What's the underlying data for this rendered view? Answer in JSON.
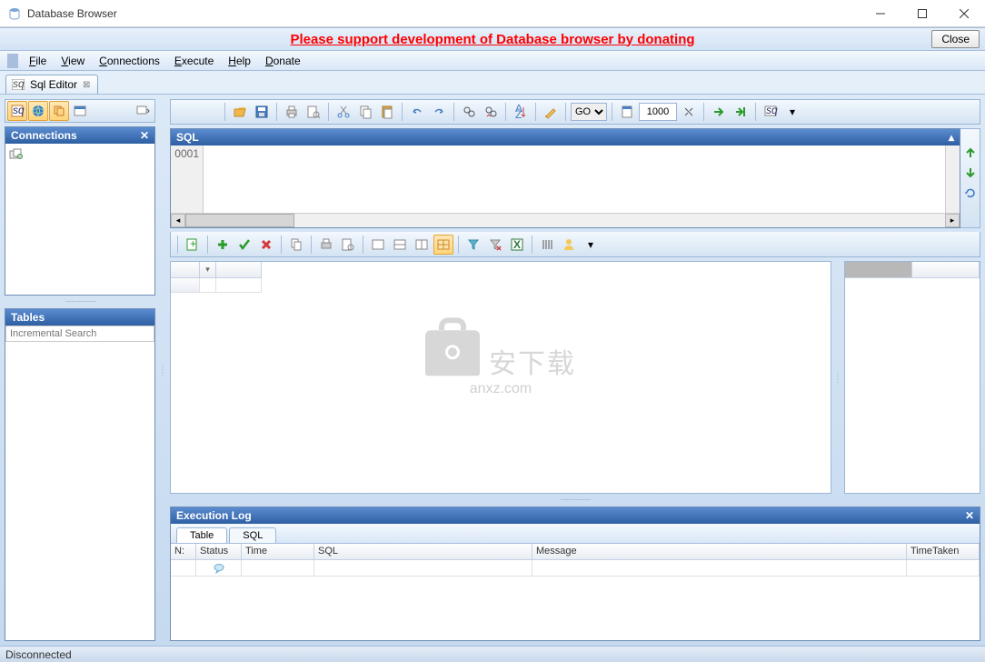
{
  "window": {
    "title": "Database Browser"
  },
  "banner": {
    "text": "Please support development of Database browser by donating",
    "close": "Close"
  },
  "menu": {
    "file": "File",
    "view": "View",
    "connections": "Connections",
    "execute": "Execute",
    "help": "Help",
    "donate": "Donate"
  },
  "tab": {
    "label": "Sql Editor"
  },
  "panels": {
    "connections": "Connections",
    "tables": "Tables",
    "sql": "SQL",
    "exec_log": "Execution Log"
  },
  "tables": {
    "search_placeholder": "Incremental Search"
  },
  "toolbar": {
    "go": "GO",
    "limit": "1000"
  },
  "sql": {
    "line1": "0001"
  },
  "log": {
    "tab_table": "Table",
    "tab_sql": "SQL",
    "cols": {
      "n": "N:",
      "status": "Status",
      "time": "Time",
      "sql": "SQL",
      "message": "Message",
      "timetaken": "TimeTaken"
    }
  },
  "status": {
    "text": "Disconnected"
  },
  "watermark": {
    "cn": "安下载",
    "url": "anxz.com"
  },
  "colors": {
    "accent": "#2e5fa3",
    "highlight": "#ffd47a"
  }
}
